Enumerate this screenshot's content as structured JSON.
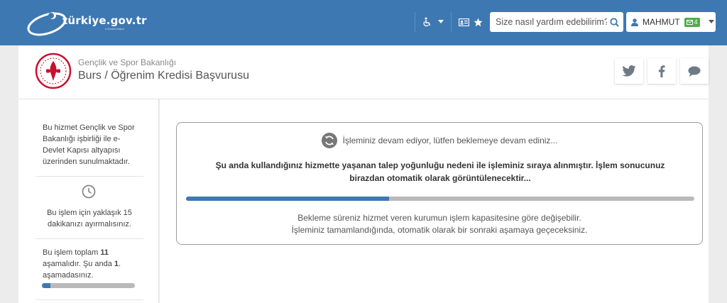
{
  "topbar": {
    "logo_text": "türkiye.gov.tr",
    "logo_subtext": "e-Devlet Kapısı",
    "search_placeholder": "Size nasıl yardım edebilirim?",
    "user_name": "MAHMUT",
    "message_count": "4"
  },
  "header": {
    "ministry": "Gençlik ve Spor Bakanlığı",
    "service_title": "Burs / Öğrenim Kredisi Başvurusu",
    "share_icons": [
      "twitter-icon",
      "facebook-icon",
      "comment-icon"
    ]
  },
  "sidebar": {
    "info_text": "Bu hizmet Gençlik ve Spor Bakanlığı işbirliği ile e-Devlet Kapısı altyapısı üzerinden sunulmaktadır.",
    "time_text": "Bu işlem için yaklaşık 15 dakikanızı ayırmalısınız.",
    "steps_prefix": "Bu işlem toplam ",
    "steps_total": "11",
    "steps_middle": " aşamalıdır. Şu anda ",
    "steps_current": "1",
    "steps_suffix": ". aşamadasınız.",
    "step_progress_fraction": 0.09
  },
  "status": {
    "waiting_text": "İşleminiz devam ediyor, lütfen beklemeye devam ediniz...",
    "queue_notice": "Şu anda kullandığınız hizmette yaşanan talep yoğunluğu nedeni ile işleminiz sıraya alınmıştır. İşlem sonucunuz birazdan otomatik olarak görüntülenecektir...",
    "progress_fraction": 0.4,
    "note_line1": "Bekleme süreniz hizmet veren kurumun işlem kapasitesine göre değişebilir.",
    "note_line2": "İşleminiz tamamlandığında, otomatik olarak bir sonraki aşamaya geçeceksiniz."
  },
  "colors": {
    "topbar": "#3e78b2",
    "accent": "#3e78b2",
    "badge": "#4cae4c",
    "emblem": "#c8102e"
  }
}
